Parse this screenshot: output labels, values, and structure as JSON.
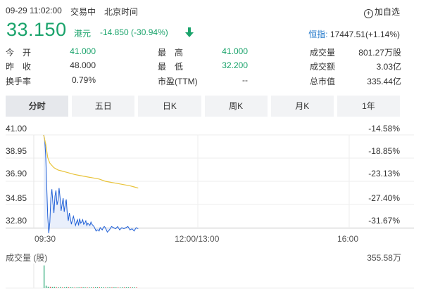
{
  "header": {
    "datetime": "09-29 11:02:00",
    "status": "交易中",
    "timezone": "北京时间",
    "add_watchlist": "加自选",
    "add_icon": "add-circle-icon"
  },
  "quote": {
    "price": "33.150",
    "currency": "港元",
    "change": "-14.850",
    "change_pct": "(-30.94%)",
    "direction_icon": "arrow-down-icon",
    "color_down": "#1aa36b"
  },
  "index": {
    "label": "恒指:",
    "value": "17447.51(+1.14%)"
  },
  "stats": [
    [
      {
        "k": "今　开",
        "v": "41.000",
        "green": true
      },
      {
        "k": "最　高",
        "v": "41.000",
        "green": true
      },
      {
        "k": "成交量",
        "v": "801.27万股",
        "green": false
      }
    ],
    [
      {
        "k": "昨　收",
        "v": "48.000",
        "green": false
      },
      {
        "k": "最　低",
        "v": "32.200",
        "green": true
      },
      {
        "k": "成交额",
        "v": "3.03亿",
        "green": false
      }
    ],
    [
      {
        "k": "换手率",
        "v": "0.79%",
        "green": false
      },
      {
        "k": "市盈(TTM)",
        "v": "--",
        "green": false
      },
      {
        "k": "总市值",
        "v": "335.44亿",
        "green": false
      }
    ]
  ],
  "tabs": [
    "分时",
    "五日",
    "日K",
    "周K",
    "月K",
    "1年"
  ],
  "active_tab": 0,
  "chart_data": {
    "type": "line",
    "y_ticks": [
      "41.00",
      "38.95",
      "36.90",
      "34.85",
      "32.80"
    ],
    "pct_ticks": [
      "-14.58%",
      "-18.85%",
      "-23.13%",
      "-27.40%",
      "-31.67%"
    ],
    "x_ticks": [
      "09:30",
      "12:00/13:00",
      "16:00"
    ],
    "ylim": [
      32.8,
      41.0
    ],
    "series": [
      {
        "color": "#1f5fd6",
        "x_minutes": [
          0,
          1,
          2,
          3,
          4,
          5,
          6,
          7,
          8,
          9,
          10,
          11,
          12,
          13,
          14,
          15,
          16,
          17,
          18,
          19,
          20,
          21,
          22,
          23,
          24,
          25,
          26,
          27,
          28,
          29,
          30,
          31,
          32,
          33,
          34,
          35,
          36,
          37,
          38,
          39,
          40,
          41,
          42,
          43,
          44,
          45,
          46,
          47,
          48,
          49,
          50,
          51,
          52,
          53,
          54,
          55,
          56,
          57,
          58,
          59,
          60,
          62,
          64,
          66,
          68,
          70,
          72,
          74,
          76,
          78,
          80,
          82,
          84,
          86,
          88,
          90,
          92
        ],
        "values": [
          41.0,
          40.6,
          39.2,
          36.4,
          33.8,
          32.3,
          33.3,
          35.4,
          36.2,
          35.0,
          34.1,
          35.6,
          36.1,
          34.8,
          35.2,
          36.3,
          35.4,
          34.3,
          34.9,
          35.4,
          34.2,
          34.9,
          35.3,
          34.0,
          33.4,
          34.1,
          33.6,
          33.1,
          33.5,
          33.8,
          33.4,
          33.0,
          33.3,
          33.5,
          33.0,
          33.6,
          33.2,
          33.3,
          33.5,
          33.1,
          33.2,
          33.4,
          33.0,
          33.2,
          33.1,
          33.0,
          33.3,
          33.1,
          33.0,
          32.9,
          32.7,
          32.5,
          32.6,
          32.6,
          32.5,
          32.8,
          32.7,
          32.6,
          32.8,
          32.9,
          32.8,
          32.4,
          32.6,
          32.9,
          32.8,
          32.7,
          32.9,
          32.6,
          32.8,
          32.7,
          32.8,
          32.9,
          32.6,
          32.7,
          32.5,
          32.8,
          32.7
        ]
      },
      {
        "color": "#e8c33a",
        "x_minutes": [
          0,
          2,
          4,
          6,
          8,
          10,
          14,
          18,
          22,
          26,
          30,
          36,
          42,
          48,
          54,
          60,
          66,
          72,
          78,
          84,
          88,
          92
        ],
        "values": [
          41.0,
          40.2,
          39.0,
          38.5,
          38.3,
          38.1,
          37.9,
          37.8,
          37.7,
          37.6,
          37.5,
          37.4,
          37.3,
          37.2,
          37.1,
          36.9,
          36.8,
          36.7,
          36.6,
          36.5,
          36.4,
          36.3
        ]
      }
    ],
    "volume": {
      "title": "成交量 (股)",
      "max_label": "355.58万",
      "bars": [
        95,
        10,
        6,
        5,
        4,
        5,
        4,
        3,
        4,
        3,
        3,
        4,
        3,
        3,
        2,
        3,
        3,
        2,
        2,
        3,
        2,
        2,
        2,
        2,
        3,
        2,
        2,
        2,
        2,
        2,
        2,
        2,
        2,
        2,
        2,
        2,
        2,
        2,
        2,
        2,
        2,
        2,
        2,
        2,
        2,
        2
      ]
    }
  }
}
